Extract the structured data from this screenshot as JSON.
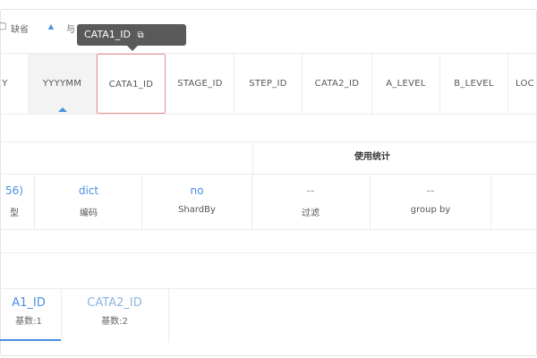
{
  "toolbar": {
    "first_label": "缺省",
    "second_label": "与"
  },
  "tooltip": {
    "text": "CATA1_ID"
  },
  "columns": [
    "Y",
    "YYYYMM",
    "CATA1_ID",
    "STAGE_ID",
    "STEP_ID",
    "CATA2_ID",
    "A_LEVEL",
    "B_LEVEL",
    "LOC"
  ],
  "usage": {
    "title": "使用统计",
    "metrics": [
      {
        "value": "56)",
        "label": "型"
      },
      {
        "value": "dict",
        "label": "编码"
      },
      {
        "value": "no",
        "label": "ShardBy"
      },
      {
        "value": "--",
        "label": "过滤"
      },
      {
        "value": "--",
        "label": "group by"
      }
    ]
  },
  "tabs": [
    {
      "name": "A1_ID",
      "count": "基数:1",
      "active": true
    },
    {
      "name": "CATA2_ID",
      "count": "基数:2",
      "active": false
    }
  ],
  "colors": {
    "accent": "#4a90e2",
    "selected_border": "#e58d8d",
    "tooltip_bg": "#5a5a5a"
  }
}
